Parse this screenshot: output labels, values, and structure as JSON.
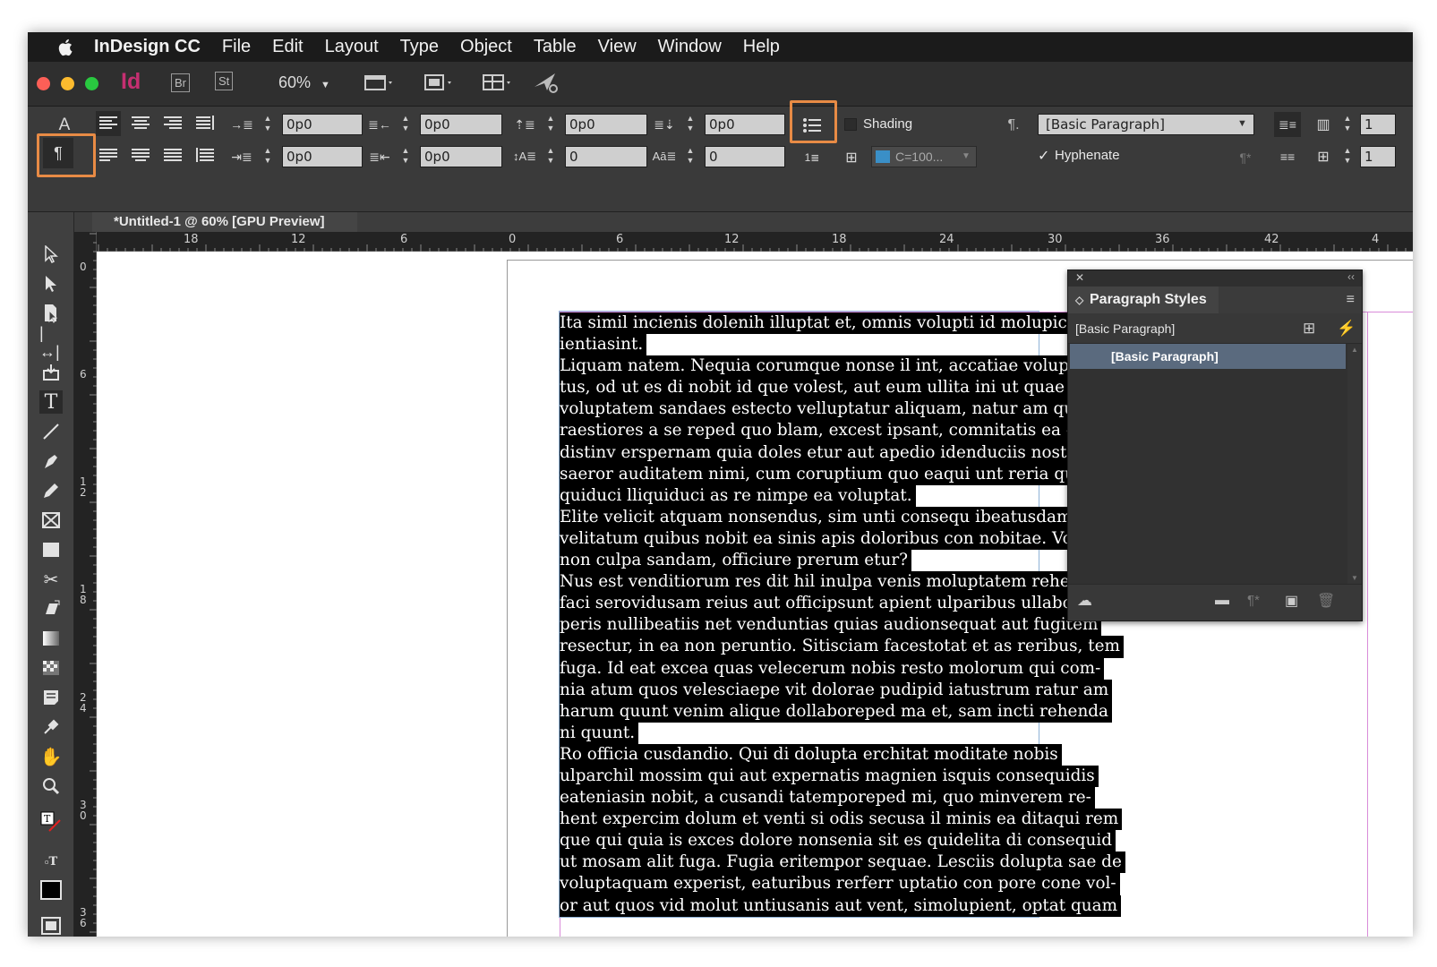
{
  "menubar": {
    "app_name": "InDesign CC",
    "menus": [
      "File",
      "Edit",
      "Layout",
      "Type",
      "Object",
      "Table",
      "View",
      "Window",
      "Help"
    ]
  },
  "appbar": {
    "app_logo": "Id",
    "bridge": "Br",
    "stock": "St",
    "zoom": "60%"
  },
  "control": {
    "indent_left": "0p0",
    "indent_right": "0p0",
    "first_line_indent": "0p0",
    "last_line_indent": "0p0",
    "space_before": "0p0",
    "space_after": "0p0",
    "drop_cap_lines": "0",
    "drop_cap_chars": "0",
    "shading_label": "Shading",
    "shading_color": "C=100...",
    "shading_swatch": "#3a8fc7",
    "paragraph_style": "[Basic Paragraph]",
    "hyphenate_label": "Hyphenate",
    "hyphenate_checked": true,
    "columns": "1"
  },
  "document_tab": {
    "title": "*Untitled-1 @ 60% [GPU Preview]"
  },
  "rulers": {
    "h_ticks": [
      "18",
      "12",
      "6",
      "0",
      "6",
      "12",
      "18",
      "24",
      "30",
      "36",
      "42",
      "4"
    ],
    "v_ticks": [
      "0",
      "6",
      "1\n2",
      "1\n8",
      "2\n4",
      "3\n0",
      "3\n6"
    ]
  },
  "text_frame": {
    "lines": [
      "Ita simil incienis dolenih illuptat et, omnis volupti id molupic",
      "ientiasint.",
      "Liquam natem. Nequia corumque nonse il int, accatiae volup-",
      "tus, od ut es di nobit id que volest, aut eum ullita ini ut quae nem",
      "voluptatem sandaes estecto velluptatur aliquam, natur am quiantur",
      "raestiores a se reped quo blam, excest ipsant, comnitatis ea que",
      "distinv erspernam quia doles etur aut apedio idenduciis nostior",
      "saeror auditatem nimi, cum coruptium quo eaqui unt reria quodit",
      "quiduci lliquiduci as re nimpe ea voluptat.",
      "Elite velicit atquam nonsendus, sim unti consequ ibeatusdam,",
      "velitatum quibus nobit ea sinis apis doloribus con nobitae. Volupti",
      "non culpa sandam, officiure prerum etur?",
      "Nus est venditiorum res dit hil inulpa venis moluptatem rehendest",
      "faci serovidusam reius aut officipsunt apient ulparibus ullabo. Itas-",
      "peris nullibeatiis net venduntias quias audionsequat aut fugitem",
      "resectur, in ea non peruntio. Sitisciam facestotat et as reribus, tem",
      "fuga. Id eat excea quas velecerum nobis resto molorum qui com-",
      "nia atum quos velesciaepe vit dolorae pudipid iatustrum ratur am",
      "harum quunt venim alique dollaboreped ma et, sam incti rehenda",
      "ni quunt.",
      "Ro officia cusdandio. Qui di dolupta erchitat moditate nobis",
      "ulparchil mossim qui aut expernatis magnien isquis consequidis",
      "eateniasin nobit, a cusandi tatemporeped mi, quo minverem re-",
      "hent expercim dolum et venti si odis secusa il minis ea ditaqui rem",
      "que qui quia is exces dolore nonsenia sit es quidelita di consequid",
      "ut mosam alit fuga. Fugia eritempor sequae. Lesciis dolupta sae de",
      "voluptaquam experist, eaturibus rerferr uptatio con pore cone vol-",
      "or aut quos vid molut untiusanis aut vent, simolupient, optat quam"
    ]
  },
  "paragraph_styles_panel": {
    "title": "Paragraph Styles",
    "current_style": "[Basic Paragraph]",
    "items": [
      "[Basic Paragraph]"
    ]
  },
  "highlight_color": "#e88b45"
}
